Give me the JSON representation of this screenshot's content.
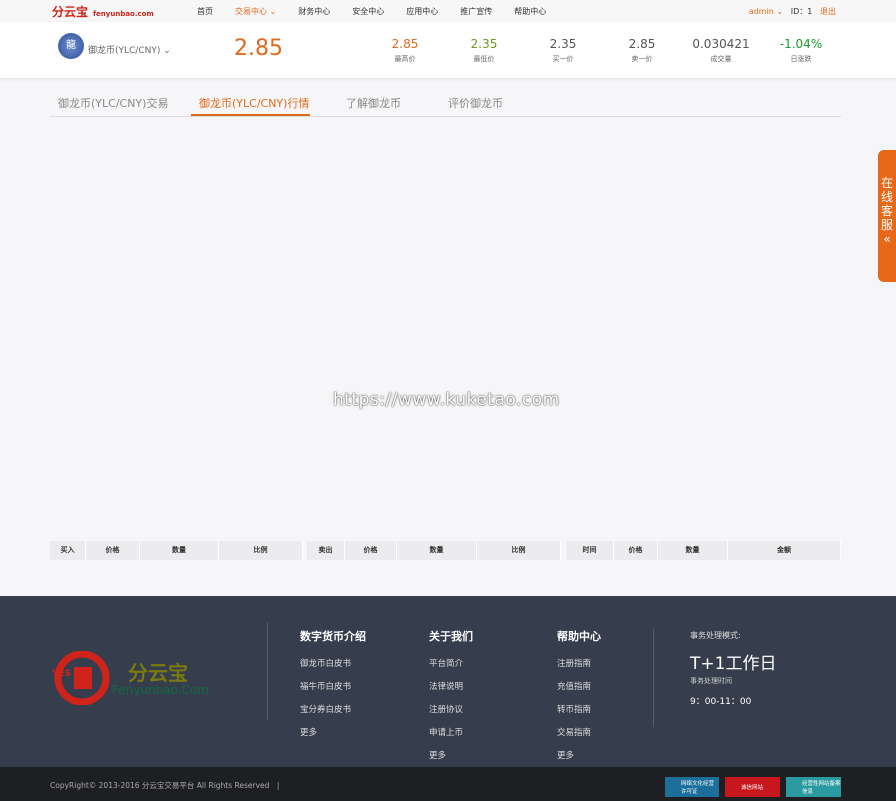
{
  "topbar": {
    "logo": "分云宝",
    "domain": "fenyunbao.com",
    "nav": [
      "首页",
      "交易中心 ⌄",
      "财务中心",
      "安全中心",
      "应用中心",
      "推广宣传",
      "帮助中心"
    ],
    "user": "admin ⌄",
    "id": "ID：1",
    "logout": "退出"
  },
  "ticker": {
    "coin": "御龙币(YLC/CNY)",
    "price": "2.85",
    "stats": [
      {
        "value": "2.85",
        "label": "最高价",
        "color": "#e06a1b"
      },
      {
        "value": "2.35",
        "label": "最低价",
        "color": "#6a9a1f"
      },
      {
        "value": "2.35",
        "label": "买一价",
        "color": "#555"
      },
      {
        "value": "2.85",
        "label": "卖一价",
        "color": "#555"
      },
      {
        "value": "0.030421",
        "label": "成交量",
        "color": "#555"
      },
      {
        "value": "-1.04%",
        "label": "日涨跌",
        "color": "#1a9a2a"
      }
    ]
  },
  "tabs": [
    "御龙币(YLC/CNY)交易",
    "御龙币(YLC/CNY)行情",
    "了解御龙币",
    "评价御龙币"
  ],
  "watermark": "https://www.kuketao.com",
  "tables": {
    "buy": [
      "买入",
      "价格",
      "数量",
      "比例"
    ],
    "sell": [
      "卖出",
      "价格",
      "数量",
      "比例"
    ],
    "trades": [
      "时间",
      "价格",
      "数量",
      "金额"
    ]
  },
  "side": {
    "label": "在线客服",
    "arrow": "«"
  },
  "footer": {
    "logo_text": "分云宝",
    "logo_sub": "Fenyunbao.Com",
    "logo_badge": "YES",
    "cols": [
      {
        "title": "数字货币介绍",
        "items": [
          "御龙币白皮书",
          "福牛币白皮书",
          "宝分券白皮书",
          "更多"
        ]
      },
      {
        "title": "关于我们",
        "items": [
          "平台简介",
          "法律说明",
          "注册协议",
          "申请上币",
          "更多"
        ]
      },
      {
        "title": "帮助中心",
        "items": [
          "注册指南",
          "充值指南",
          "转币指南",
          "交易指南",
          "更多"
        ]
      }
    ],
    "mode_label": "事务处理模式:",
    "mode": "T+1工作日",
    "time_label": "事务处理时间",
    "time": "9：00-11：00"
  },
  "bottom": {
    "copyright": "CopyRight© 2013-2016 分云宝交易平台 All Rights Reserved　|",
    "badges": [
      "网络文化经营许可证",
      "诚信网站",
      "经营性网站备案信息"
    ]
  }
}
